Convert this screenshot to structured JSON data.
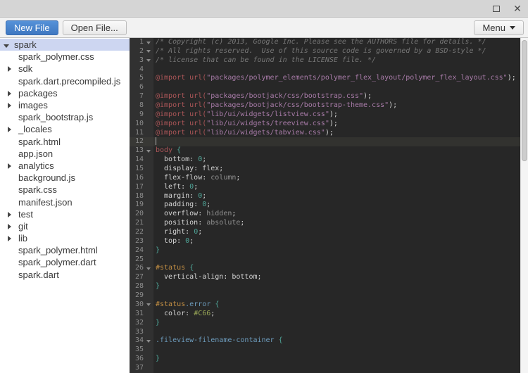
{
  "window": {
    "controls": {
      "maximize": "maximize-icon",
      "close": "close-icon",
      "close_glyph": "✕"
    }
  },
  "toolbar": {
    "new_file_label": "New File",
    "open_file_label": "Open File...",
    "menu_label": "Menu"
  },
  "colors": {
    "accent_button": "#4787ed",
    "tree_selection": "#cdd6f1",
    "editor_background": "#272727",
    "gutter_background": "#313131",
    "syntax": {
      "comment": "#767676",
      "atrule": "#ac5658",
      "string": "#a87ba8",
      "plain": "#d4d4d4",
      "keyword_value": "#8f8f8f",
      "number_brace": "#4fa598",
      "id_selector": "#c08d43",
      "class_selector": "#6d9cbd",
      "hex_value": "#98a656"
    }
  },
  "sidebar": {
    "items": [
      {
        "label": "spark",
        "arrow": "expanded",
        "depth": 0,
        "selected": true
      },
      {
        "label": "spark_polymer.css",
        "arrow": null,
        "depth": 1,
        "selected": false
      },
      {
        "label": "sdk",
        "arrow": "collapsed",
        "depth": 1,
        "selected": false
      },
      {
        "label": "spark.dart.precompiled.js",
        "arrow": null,
        "depth": 1,
        "selected": false
      },
      {
        "label": "packages",
        "arrow": "collapsed",
        "depth": 1,
        "selected": false
      },
      {
        "label": "images",
        "arrow": "collapsed",
        "depth": 1,
        "selected": false
      },
      {
        "label": "spark_bootstrap.js",
        "arrow": null,
        "depth": 1,
        "selected": false
      },
      {
        "label": "_locales",
        "arrow": "collapsed",
        "depth": 1,
        "selected": false
      },
      {
        "label": "spark.html",
        "arrow": null,
        "depth": 1,
        "selected": false
      },
      {
        "label": "app.json",
        "arrow": null,
        "depth": 1,
        "selected": false
      },
      {
        "label": "analytics",
        "arrow": "collapsed",
        "depth": 1,
        "selected": false
      },
      {
        "label": "background.js",
        "arrow": null,
        "depth": 1,
        "selected": false
      },
      {
        "label": "spark.css",
        "arrow": null,
        "depth": 1,
        "selected": false
      },
      {
        "label": "manifest.json",
        "arrow": null,
        "depth": 1,
        "selected": false
      },
      {
        "label": "test",
        "arrow": "collapsed",
        "depth": 1,
        "selected": false
      },
      {
        "label": "git",
        "arrow": "collapsed",
        "depth": 1,
        "selected": false
      },
      {
        "label": "lib",
        "arrow": "collapsed",
        "depth": 1,
        "selected": false
      },
      {
        "label": "spark_polymer.html",
        "arrow": null,
        "depth": 1,
        "selected": false
      },
      {
        "label": "spark_polymer.dart",
        "arrow": null,
        "depth": 1,
        "selected": false
      },
      {
        "label": "spark.dart",
        "arrow": null,
        "depth": 1,
        "selected": false
      }
    ]
  },
  "editor": {
    "lines": [
      {
        "n": 1,
        "fold": true,
        "segs": [
          {
            "c": "comment",
            "t": "/* Copyright (c) 2013, Google Inc. Please see the AUTHORS file for details. */"
          }
        ]
      },
      {
        "n": 2,
        "fold": true,
        "segs": [
          {
            "c": "comment",
            "t": "/* All rights reserved.  Use of this source code is governed by a BSD-style */"
          }
        ]
      },
      {
        "n": 3,
        "fold": true,
        "segs": [
          {
            "c": "comment",
            "t": "/* license that can be found in the LICENSE file. */"
          }
        ]
      },
      {
        "n": 4,
        "segs": []
      },
      {
        "n": 5,
        "segs": [
          {
            "c": "red",
            "t": "@import url("
          },
          {
            "c": "purple",
            "t": "\"packages/polymer_elements/polymer_flex_layout/polymer_flex_layout.css\""
          },
          {
            "c": "plain",
            "t": ");"
          }
        ]
      },
      {
        "n": 6,
        "segs": []
      },
      {
        "n": 7,
        "segs": [
          {
            "c": "red",
            "t": "@import url("
          },
          {
            "c": "purple",
            "t": "\"packages/bootjack/css/bootstrap.css\""
          },
          {
            "c": "plain",
            "t": ");"
          }
        ]
      },
      {
        "n": 8,
        "segs": [
          {
            "c": "red",
            "t": "@import url("
          },
          {
            "c": "purple",
            "t": "\"packages/bootjack/css/bootstrap-theme.css\""
          },
          {
            "c": "plain",
            "t": ");"
          }
        ]
      },
      {
        "n": 9,
        "segs": [
          {
            "c": "red",
            "t": "@import url("
          },
          {
            "c": "purple",
            "t": "\"lib/ui/widgets/listview.css\""
          },
          {
            "c": "plain",
            "t": ");"
          }
        ]
      },
      {
        "n": 10,
        "segs": [
          {
            "c": "red",
            "t": "@import url("
          },
          {
            "c": "purple",
            "t": "\"lib/ui/widgets/treeview.css\""
          },
          {
            "c": "plain",
            "t": ");"
          }
        ]
      },
      {
        "n": 11,
        "segs": [
          {
            "c": "red",
            "t": "@import url("
          },
          {
            "c": "purple",
            "t": "\"lib/ui/widgets/tabview.css\""
          },
          {
            "c": "plain",
            "t": ");"
          }
        ]
      },
      {
        "n": 12,
        "active": true,
        "cursor": true,
        "segs": []
      },
      {
        "n": 13,
        "fold": true,
        "segs": [
          {
            "c": "red",
            "t": "body"
          },
          {
            "c": "plain",
            "t": " "
          },
          {
            "c": "teal",
            "t": "{"
          }
        ]
      },
      {
        "n": 14,
        "segs": [
          {
            "c": "plain",
            "t": "  bottom: "
          },
          {
            "c": "teal",
            "t": "0"
          },
          {
            "c": "plain",
            "t": ";"
          }
        ]
      },
      {
        "n": 15,
        "segs": [
          {
            "c": "plain",
            "t": "  display: flex;"
          }
        ]
      },
      {
        "n": 16,
        "segs": [
          {
            "c": "plain",
            "t": "  flex-flow: "
          },
          {
            "c": "gray",
            "t": "column"
          },
          {
            "c": "plain",
            "t": ";"
          }
        ]
      },
      {
        "n": 17,
        "segs": [
          {
            "c": "plain",
            "t": "  left: "
          },
          {
            "c": "teal",
            "t": "0"
          },
          {
            "c": "plain",
            "t": ";"
          }
        ]
      },
      {
        "n": 18,
        "segs": [
          {
            "c": "plain",
            "t": "  margin: "
          },
          {
            "c": "teal",
            "t": "0"
          },
          {
            "c": "plain",
            "t": ";"
          }
        ]
      },
      {
        "n": 19,
        "segs": [
          {
            "c": "plain",
            "t": "  padding: "
          },
          {
            "c": "teal",
            "t": "0"
          },
          {
            "c": "plain",
            "t": ";"
          }
        ]
      },
      {
        "n": 20,
        "segs": [
          {
            "c": "plain",
            "t": "  overflow: "
          },
          {
            "c": "gray",
            "t": "hidden"
          },
          {
            "c": "plain",
            "t": ";"
          }
        ]
      },
      {
        "n": 21,
        "segs": [
          {
            "c": "plain",
            "t": "  position: "
          },
          {
            "c": "gray",
            "t": "absolute"
          },
          {
            "c": "plain",
            "t": ";"
          }
        ]
      },
      {
        "n": 22,
        "segs": [
          {
            "c": "plain",
            "t": "  right: "
          },
          {
            "c": "teal",
            "t": "0"
          },
          {
            "c": "plain",
            "t": ";"
          }
        ]
      },
      {
        "n": 23,
        "segs": [
          {
            "c": "plain",
            "t": "  top: "
          },
          {
            "c": "teal",
            "t": "0"
          },
          {
            "c": "plain",
            "t": ";"
          }
        ]
      },
      {
        "n": 24,
        "segs": [
          {
            "c": "teal",
            "t": "}"
          }
        ]
      },
      {
        "n": 25,
        "segs": []
      },
      {
        "n": 26,
        "fold": true,
        "segs": [
          {
            "c": "orange",
            "t": "#status"
          },
          {
            "c": "plain",
            "t": " "
          },
          {
            "c": "teal",
            "t": "{"
          }
        ]
      },
      {
        "n": 27,
        "segs": [
          {
            "c": "plain",
            "t": "  vertical-align: bottom;"
          }
        ]
      },
      {
        "n": 28,
        "segs": [
          {
            "c": "teal",
            "t": "}"
          }
        ]
      },
      {
        "n": 29,
        "segs": []
      },
      {
        "n": 30,
        "fold": true,
        "segs": [
          {
            "c": "orange",
            "t": "#status"
          },
          {
            "c": "blue",
            "t": ".error"
          },
          {
            "c": "plain",
            "t": " "
          },
          {
            "c": "teal",
            "t": "{"
          }
        ]
      },
      {
        "n": 31,
        "segs": [
          {
            "c": "plain",
            "t": "  color: "
          },
          {
            "c": "green",
            "t": "#C66"
          },
          {
            "c": "plain",
            "t": ";"
          }
        ]
      },
      {
        "n": 32,
        "segs": [
          {
            "c": "teal",
            "t": "}"
          }
        ]
      },
      {
        "n": 33,
        "segs": []
      },
      {
        "n": 34,
        "fold": true,
        "segs": [
          {
            "c": "blue",
            "t": ".fileview-filename-container"
          },
          {
            "c": "plain",
            "t": " "
          },
          {
            "c": "teal",
            "t": "{"
          }
        ]
      },
      {
        "n": 35,
        "segs": []
      },
      {
        "n": 36,
        "segs": [
          {
            "c": "teal",
            "t": "}"
          }
        ]
      },
      {
        "n": 37,
        "segs": []
      }
    ]
  }
}
